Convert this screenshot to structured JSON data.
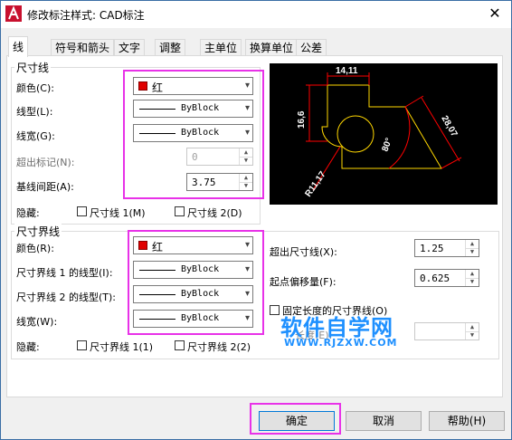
{
  "window": {
    "title": "修改标注样式: CAD标注",
    "close_glyph": "✕"
  },
  "tabs": [
    {
      "label": "线"
    },
    {
      "label": "符号和箭头"
    },
    {
      "label": "文字"
    },
    {
      "label": "调整"
    },
    {
      "label": "主单位"
    },
    {
      "label": "换算单位"
    },
    {
      "label": "公差"
    }
  ],
  "dim_lines": {
    "group_title": "尺寸线",
    "color_label": "颜色(C):",
    "color_value": "红",
    "linetype_label": "线型(L):",
    "linetype_value": "ByBlock",
    "lineweight_label": "线宽(G):",
    "lineweight_value": "ByBlock",
    "extend_label": "超出标记(N):",
    "extend_value": "0",
    "baseline_label": "基线间距(A):",
    "baseline_value": "3.75",
    "suppress_label": "隐藏:",
    "suppress_1": "尺寸线 1(M)",
    "suppress_2": "尺寸线 2(D)"
  },
  "preview": {
    "dim_top": "14,11",
    "dim_left": "16,6",
    "dim_diag": "28,07",
    "dim_angle": "80°",
    "dim_radius": "R11,17"
  },
  "ext_lines": {
    "group_title": "尺寸界线",
    "color_label": "颜色(R):",
    "color_value": "红",
    "ext1_label": "尺寸界线 1 的线型(I):",
    "ext1_value": "ByBlock",
    "ext2_label": "尺寸界线 2 的线型(T):",
    "ext2_value": "ByBlock",
    "lineweight_label": "线宽(W):",
    "lineweight_value": "ByBlock",
    "beyond_label": "超出尺寸线(X):",
    "beyond_value": "1.25",
    "offset_label": "起点偏移量(F):",
    "offset_value": "0.625",
    "fixed_label": "固定长度的尺寸界线(O)",
    "length_label": "长度(E):",
    "suppress_label": "隐藏:",
    "suppress_1": "尺寸界线 1(1)",
    "suppress_2": "尺寸界线 2(2)"
  },
  "watermark": {
    "title": "软件自学网",
    "url": "WWW.RJZXW.COM"
  },
  "buttons": {
    "ok": "确定",
    "cancel": "取消",
    "help": "帮助(H)"
  },
  "colors": {
    "highlight": "#e832e8",
    "swatch_red": "#e00000",
    "preview_geometry": "#ffd700",
    "preview_dims": "#ff0000",
    "preview_text": "#ffffff"
  }
}
